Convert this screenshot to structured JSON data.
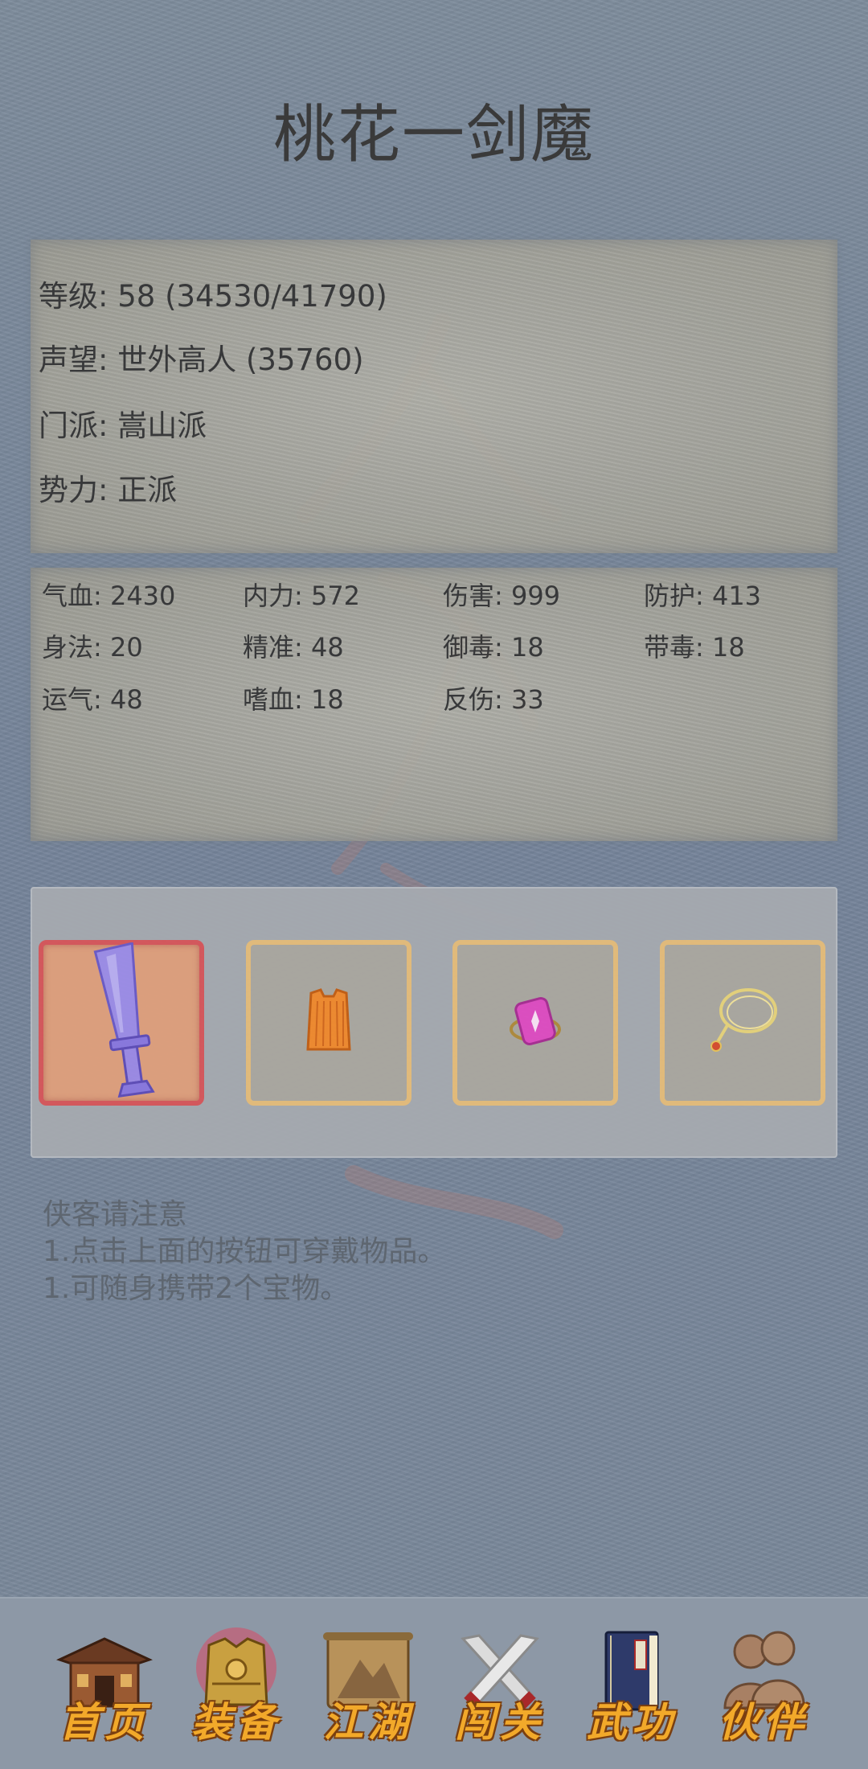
{
  "title": "桃花一剑魔",
  "info": {
    "level": "等级: 58 (34530/41790)",
    "reputation": "声望: 世外高人 (35760)",
    "sect": "门派: 嵩山派",
    "faction": "势力:  正派"
  },
  "stats": [
    [
      "气血: 2430",
      "内力: 572",
      "伤害: 999",
      "防护: 413"
    ],
    [
      "身法: 20",
      "精准: 48",
      "御毒: 18",
      "带毒: 18"
    ],
    [
      "运气: 48",
      "嗜血: 18",
      "反伤: 33"
    ]
  ],
  "equipment": {
    "slots": [
      {
        "icon": "sword-icon",
        "selected": true
      },
      {
        "icon": "armor-icon",
        "selected": false
      },
      {
        "icon": "ring-icon",
        "selected": false
      },
      {
        "icon": "necklace-icon",
        "selected": false
      }
    ]
  },
  "notice": {
    "heading": "侠客请注意",
    "line1": "1.点击上面的按钮可穿戴物品。",
    "line2": "1.可随身携带2个宝物。"
  },
  "nav": [
    {
      "label": "首页",
      "icon": "house-icon"
    },
    {
      "label": "装备",
      "icon": "armor-icon"
    },
    {
      "label": "江湖",
      "icon": "scroll-map-icon"
    },
    {
      "label": "闯关",
      "icon": "crossed-swords-icon"
    },
    {
      "label": "武功",
      "icon": "book-icon"
    },
    {
      "label": "伙伴",
      "icon": "companions-icon"
    }
  ]
}
